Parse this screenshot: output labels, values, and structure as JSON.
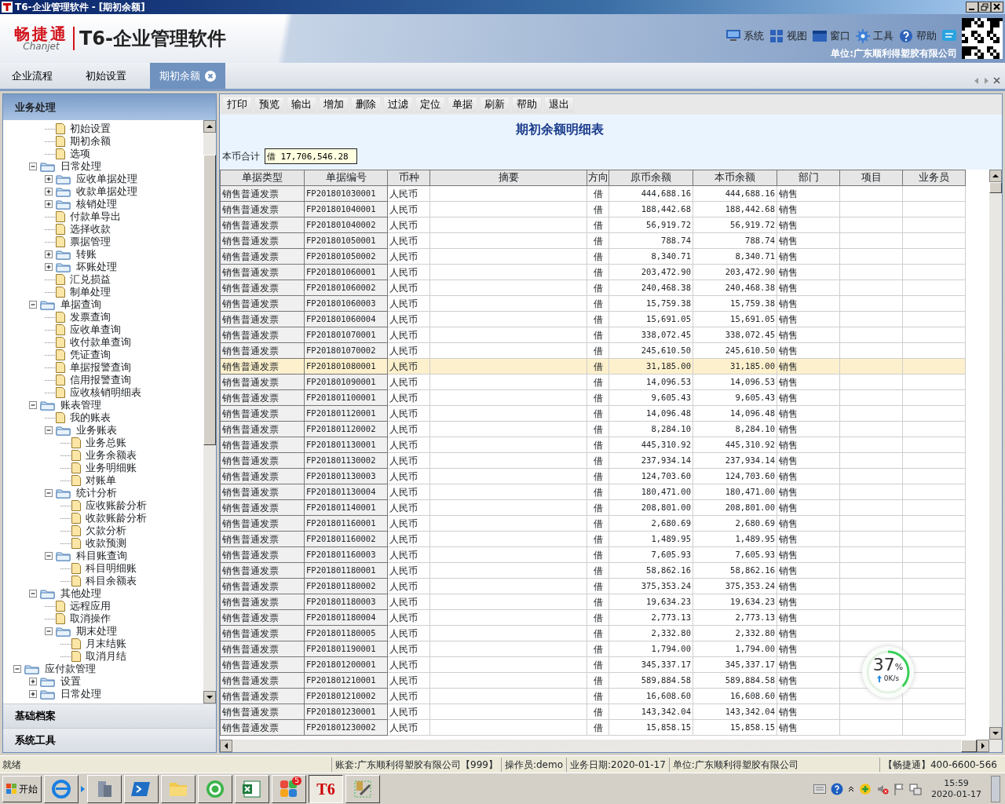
{
  "window": {
    "title": "T6-企业管理软件 - [期初余额]"
  },
  "header": {
    "brand": "畅捷通",
    "brand_sub": "Chanjet",
    "product": "T6-企业管理软件",
    "menu": [
      {
        "label": "系统"
      },
      {
        "label": "视图"
      },
      {
        "label": "窗口"
      },
      {
        "label": "工具"
      },
      {
        "label": "帮助"
      }
    ],
    "unit": "单位:广东顺利得塑胶有限公司"
  },
  "tabs": [
    {
      "label": "企业流程",
      "selected": false
    },
    {
      "label": "初始设置",
      "selected": false
    },
    {
      "label": "期初余额",
      "selected": true
    }
  ],
  "sidebar": {
    "title": "业务处理",
    "sections": [
      "基础档案",
      "系统工具"
    ],
    "tree": [
      {
        "children": [
          {
            "children": [
              {
                "kind": "leaf",
                "label": "初始设置"
              },
              {
                "kind": "leaf",
                "label": "期初余额"
              },
              {
                "kind": "leaf",
                "label": "选项"
              }
            ]
          },
          {
            "kind": "folder",
            "label": "日常处理",
            "expanded": true,
            "children": [
              {
                "kind": "folder",
                "label": "应收单据处理",
                "expanded": false
              },
              {
                "kind": "folder",
                "label": "收款单据处理",
                "expanded": false
              },
              {
                "kind": "folder",
                "label": "核销处理",
                "expanded": false
              },
              {
                "kind": "leaf",
                "label": "付款单导出"
              },
              {
                "kind": "leaf",
                "label": "选择收款"
              },
              {
                "kind": "leaf",
                "label": "票据管理"
              },
              {
                "kind": "folder",
                "label": "转账",
                "expanded": false
              },
              {
                "kind": "folder",
                "label": "坏账处理",
                "expanded": false
              },
              {
                "kind": "leaf",
                "label": "汇兑损益"
              },
              {
                "kind": "leaf",
                "label": "制单处理"
              }
            ]
          },
          {
            "kind": "folder",
            "label": "单据查询",
            "expanded": true,
            "children": [
              {
                "kind": "leaf",
                "label": "发票查询"
              },
              {
                "kind": "leaf",
                "label": "应收单查询"
              },
              {
                "kind": "leaf",
                "label": "收付款单查询"
              },
              {
                "kind": "leaf",
                "label": "凭证查询"
              },
              {
                "kind": "leaf",
                "label": "单据报警查询"
              },
              {
                "kind": "leaf",
                "label": "信用报警查询"
              },
              {
                "kind": "leaf",
                "label": "应收核销明细表"
              }
            ]
          },
          {
            "kind": "folder",
            "label": "账表管理",
            "expanded": true,
            "children": [
              {
                "kind": "leaf",
                "label": "我的账表"
              },
              {
                "kind": "folder",
                "label": "业务账表",
                "expanded": true,
                "children": [
                  {
                    "kind": "leaf",
                    "label": "业务总账"
                  },
                  {
                    "kind": "leaf",
                    "label": "业务余额表"
                  },
                  {
                    "kind": "leaf",
                    "label": "业务明细账"
                  },
                  {
                    "kind": "leaf",
                    "label": "对账单"
                  }
                ]
              },
              {
                "kind": "folder",
                "label": "统计分析",
                "expanded": true,
                "children": [
                  {
                    "kind": "leaf",
                    "label": "应收账龄分析"
                  },
                  {
                    "kind": "leaf",
                    "label": "收款账龄分析"
                  },
                  {
                    "kind": "leaf",
                    "label": "欠款分析"
                  },
                  {
                    "kind": "leaf",
                    "label": "收款预测"
                  }
                ]
              },
              {
                "kind": "folder",
                "label": "科目账查询",
                "expanded": true,
                "children": [
                  {
                    "kind": "leaf",
                    "label": "科目明细账"
                  },
                  {
                    "kind": "leaf",
                    "label": "科目余额表"
                  }
                ]
              }
            ]
          },
          {
            "kind": "folder",
            "label": "其他处理",
            "expanded": true,
            "children": [
              {
                "kind": "leaf",
                "label": "远程应用"
              },
              {
                "kind": "leaf",
                "label": "取消操作"
              },
              {
                "kind": "folder",
                "label": "期末处理",
                "expanded": true,
                "children": [
                  {
                    "kind": "leaf",
                    "label": "月末结账"
                  },
                  {
                    "kind": "leaf",
                    "label": "取消月结"
                  }
                ]
              }
            ]
          }
        ]
      },
      {
        "kind": "folder",
        "label": "应付款管理",
        "expanded": true,
        "children": [
          {
            "kind": "folder",
            "label": "设置",
            "expanded": false
          },
          {
            "kind": "folder",
            "label": "日常处理",
            "expanded": false
          }
        ]
      }
    ]
  },
  "toolbar": [
    "打印",
    "预览",
    "输出",
    "增加",
    "删除",
    "过滤",
    "定位",
    "单据",
    "刷新",
    "帮助",
    "退出"
  ],
  "report": {
    "title": "期初余额明细表",
    "total_label": "本币合计",
    "total_value": "借 17,706,546.28"
  },
  "table": {
    "columns": [
      "单据类型",
      "单据编号",
      "币种",
      "摘要",
      "方向",
      "原币余额",
      "本币余额",
      "部门",
      "项目",
      "业务员"
    ],
    "rows": [
      {
        "type": "销售普通发票",
        "number": "FP201801030001",
        "currency": "人民币",
        "direction": "借",
        "original": "444,688.16",
        "local": "444,688.16",
        "department": "销售",
        "selected": false
      },
      {
        "type": "销售普通发票",
        "number": "FP201801040001",
        "currency": "人民币",
        "direction": "借",
        "original": "188,442.68",
        "local": "188,442.68",
        "department": "销售",
        "selected": false
      },
      {
        "type": "销售普通发票",
        "number": "FP201801040002",
        "currency": "人民币",
        "direction": "借",
        "original": "56,919.72",
        "local": "56,919.72",
        "department": "销售",
        "selected": false
      },
      {
        "type": "销售普通发票",
        "number": "FP201801050001",
        "currency": "人民币",
        "direction": "借",
        "original": "788.74",
        "local": "788.74",
        "department": "销售",
        "selected": false
      },
      {
        "type": "销售普通发票",
        "number": "FP201801050002",
        "currency": "人民币",
        "direction": "借",
        "original": "8,340.71",
        "local": "8,340.71",
        "department": "销售",
        "selected": false
      },
      {
        "type": "销售普通发票",
        "number": "FP201801060001",
        "currency": "人民币",
        "direction": "借",
        "original": "203,472.90",
        "local": "203,472.90",
        "department": "销售",
        "selected": false
      },
      {
        "type": "销售普通发票",
        "number": "FP201801060002",
        "currency": "人民币",
        "direction": "借",
        "original": "240,468.38",
        "local": "240,468.38",
        "department": "销售",
        "selected": false
      },
      {
        "type": "销售普通发票",
        "number": "FP201801060003",
        "currency": "人民币",
        "direction": "借",
        "original": "15,759.38",
        "local": "15,759.38",
        "department": "销售",
        "selected": false
      },
      {
        "type": "销售普通发票",
        "number": "FP201801060004",
        "currency": "人民币",
        "direction": "借",
        "original": "15,691.05",
        "local": "15,691.05",
        "department": "销售",
        "selected": false
      },
      {
        "type": "销售普通发票",
        "number": "FP201801070001",
        "currency": "人民币",
        "direction": "借",
        "original": "338,072.45",
        "local": "338,072.45",
        "department": "销售",
        "selected": false
      },
      {
        "type": "销售普通发票",
        "number": "FP201801070002",
        "currency": "人民币",
        "direction": "借",
        "original": "245,610.50",
        "local": "245,610.50",
        "department": "销售",
        "selected": false
      },
      {
        "type": "销售普通发票",
        "number": "FP201801080001",
        "currency": "人民币",
        "direction": "借",
        "original": "31,185.00",
        "local": "31,185.00",
        "department": "销售",
        "selected": true
      },
      {
        "type": "销售普通发票",
        "number": "FP201801090001",
        "currency": "人民币",
        "direction": "借",
        "original": "14,096.53",
        "local": "14,096.53",
        "department": "销售",
        "selected": false
      },
      {
        "type": "销售普通发票",
        "number": "FP201801100001",
        "currency": "人民币",
        "direction": "借",
        "original": "9,605.43",
        "local": "9,605.43",
        "department": "销售",
        "selected": false
      },
      {
        "type": "销售普通发票",
        "number": "FP201801120001",
        "currency": "人民币",
        "direction": "借",
        "original": "14,096.48",
        "local": "14,096.48",
        "department": "销售",
        "selected": false
      },
      {
        "type": "销售普通发票",
        "number": "FP201801120002",
        "currency": "人民币",
        "direction": "借",
        "original": "8,284.10",
        "local": "8,284.10",
        "department": "销售",
        "selected": false
      },
      {
        "type": "销售普通发票",
        "number": "FP201801130001",
        "currency": "人民币",
        "direction": "借",
        "original": "445,310.92",
        "local": "445,310.92",
        "department": "销售",
        "selected": false
      },
      {
        "type": "销售普通发票",
        "number": "FP201801130002",
        "currency": "人民币",
        "direction": "借",
        "original": "237,934.14",
        "local": "237,934.14",
        "department": "销售",
        "selected": false
      },
      {
        "type": "销售普通发票",
        "number": "FP201801130003",
        "currency": "人民币",
        "direction": "借",
        "original": "124,703.60",
        "local": "124,703.60",
        "department": "销售",
        "selected": false
      },
      {
        "type": "销售普通发票",
        "number": "FP201801130004",
        "currency": "人民币",
        "direction": "借",
        "original": "180,471.00",
        "local": "180,471.00",
        "department": "销售",
        "selected": false
      },
      {
        "type": "销售普通发票",
        "number": "FP201801140001",
        "currency": "人民币",
        "direction": "借",
        "original": "208,801.00",
        "local": "208,801.00",
        "department": "销售",
        "selected": false
      },
      {
        "type": "销售普通发票",
        "number": "FP201801160001",
        "currency": "人民币",
        "direction": "借",
        "original": "2,680.69",
        "local": "2,680.69",
        "department": "销售",
        "selected": false
      },
      {
        "type": "销售普通发票",
        "number": "FP201801160002",
        "currency": "人民币",
        "direction": "借",
        "original": "1,489.95",
        "local": "1,489.95",
        "department": "销售",
        "selected": false
      },
      {
        "type": "销售普通发票",
        "number": "FP201801160003",
        "currency": "人民币",
        "direction": "借",
        "original": "7,605.93",
        "local": "7,605.93",
        "department": "销售",
        "selected": false
      },
      {
        "type": "销售普通发票",
        "number": "FP201801180001",
        "currency": "人民币",
        "direction": "借",
        "original": "58,862.16",
        "local": "58,862.16",
        "department": "销售",
        "selected": false
      },
      {
        "type": "销售普通发票",
        "number": "FP201801180002",
        "currency": "人民币",
        "direction": "借",
        "original": "375,353.24",
        "local": "375,353.24",
        "department": "销售",
        "selected": false
      },
      {
        "type": "销售普通发票",
        "number": "FP201801180003",
        "currency": "人民币",
        "direction": "借",
        "original": "19,634.23",
        "local": "19,634.23",
        "department": "销售",
        "selected": false
      },
      {
        "type": "销售普通发票",
        "number": "FP201801180004",
        "currency": "人民币",
        "direction": "借",
        "original": "2,773.13",
        "local": "2,773.13",
        "department": "销售",
        "selected": false
      },
      {
        "type": "销售普通发票",
        "number": "FP201801180005",
        "currency": "人民币",
        "direction": "借",
        "original": "2,332.80",
        "local": "2,332.80",
        "department": "销售",
        "selected": false
      },
      {
        "type": "销售普通发票",
        "number": "FP201801190001",
        "currency": "人民币",
        "direction": "借",
        "original": "1,794.00",
        "local": "1,794.00",
        "department": "销售",
        "selected": false
      },
      {
        "type": "销售普通发票",
        "number": "FP201801200001",
        "currency": "人民币",
        "direction": "借",
        "original": "345,337.17",
        "local": "345,337.17",
        "department": "销售",
        "selected": false
      },
      {
        "type": "销售普通发票",
        "number": "FP201801210001",
        "currency": "人民币",
        "direction": "借",
        "original": "589,884.58",
        "local": "589,884.58",
        "department": "销售",
        "selected": false
      },
      {
        "type": "销售普通发票",
        "number": "FP201801210002",
        "currency": "人民币",
        "direction": "借",
        "original": "16,608.60",
        "local": "16,608.60",
        "department": "销售",
        "selected": false
      },
      {
        "type": "销售普通发票",
        "number": "FP201801230001",
        "currency": "人民币",
        "direction": "借",
        "original": "143,342.04",
        "local": "143,342.04",
        "department": "销售",
        "selected": false
      },
      {
        "type": "销售普通发票",
        "number": "FP201801230002",
        "currency": "人民币",
        "direction": "借",
        "original": "15,858.15",
        "local": "15,858.15",
        "department": "销售",
        "selected": false
      }
    ]
  },
  "speed_widget": {
    "percent": "37",
    "unit": "%",
    "rate": "0K/s",
    "level": 0.37
  },
  "status_bar": [
    "就绪",
    "账套:广东顺利得塑胶有限公司【999】",
    "操作员:demo",
    "业务日期:2020-01-17",
    "单位:广东顺利得塑胶有限公司",
    "【畅捷通】400-6600-566"
  ],
  "taskbar": {
    "start": "开始",
    "apps": [
      {
        "selected": false
      },
      {
        "selected": false
      },
      {
        "selected": false
      },
      {
        "selected": false
      },
      {
        "selected": false
      },
      {
        "selected": false
      },
      {
        "selected": false,
        "badge": "5"
      },
      {
        "selected": true,
        "label": "T6"
      },
      {
        "selected": false
      }
    ],
    "time": "15:59",
    "date": "2020-01-17"
  }
}
